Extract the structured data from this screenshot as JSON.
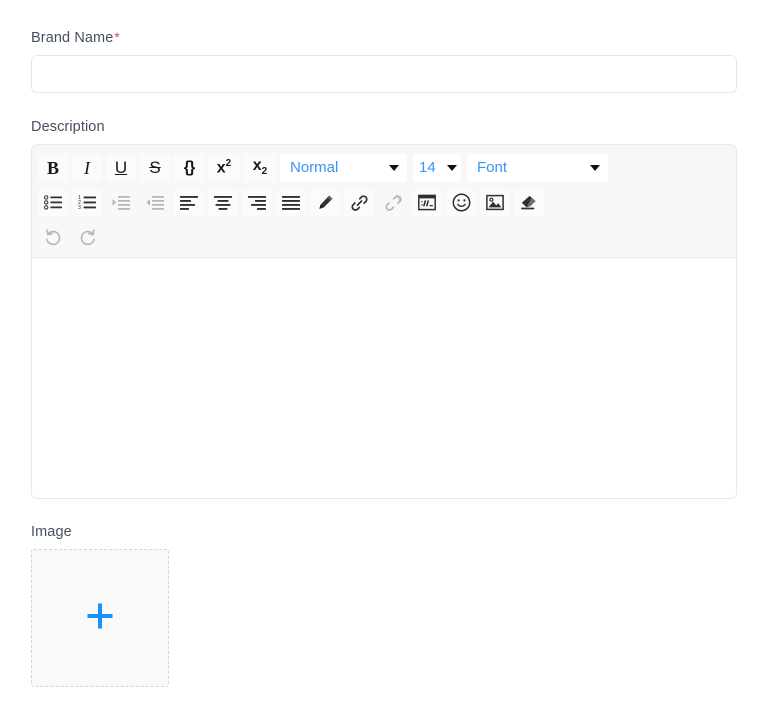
{
  "form": {
    "brand_name": {
      "label": "Brand Name",
      "required_marker": "*",
      "value": "",
      "placeholder": ""
    },
    "description": {
      "label": "Description",
      "content": "",
      "toolbar": {
        "row1": [
          {
            "name": "bold-icon",
            "label": "B",
            "title": "Bold",
            "disabled": false
          },
          {
            "name": "italic-icon",
            "label": "I",
            "title": "Italic",
            "disabled": false
          },
          {
            "name": "underline-icon",
            "label": "U",
            "title": "Underline",
            "disabled": false
          },
          {
            "name": "strikethrough-icon",
            "label": "S",
            "title": "Strike",
            "disabled": false
          },
          {
            "name": "code-block-icon",
            "label": "{}",
            "title": "Code Block",
            "disabled": false
          },
          {
            "name": "superscript-icon",
            "label": "x2",
            "title": "Superscript",
            "disabled": false
          },
          {
            "name": "subscript-icon",
            "label": "x2",
            "title": "Subscript",
            "disabled": false
          }
        ],
        "selects": {
          "header": {
            "value": "Normal",
            "name": "header-select"
          },
          "size": {
            "value": "14",
            "name": "font-size-select"
          },
          "font": {
            "value": "Font",
            "name": "font-family-select"
          }
        },
        "row2": [
          {
            "name": "bullet-list-icon",
            "title": "Bulleted list",
            "disabled": false
          },
          {
            "name": "numbered-list-icon",
            "title": "Numbered list",
            "disabled": false
          },
          {
            "name": "indent-icon",
            "title": "Indent",
            "disabled": true
          },
          {
            "name": "outdent-icon",
            "title": "Outdent",
            "disabled": true
          },
          {
            "name": "align-left-icon",
            "title": "Align left",
            "disabled": false
          },
          {
            "name": "align-center-icon",
            "title": "Align center",
            "disabled": false
          },
          {
            "name": "align-right-icon",
            "title": "Align right",
            "disabled": false
          },
          {
            "name": "align-justify-icon",
            "title": "Justify",
            "disabled": false
          },
          {
            "name": "pen-icon",
            "title": "Text color",
            "disabled": false
          },
          {
            "name": "link-icon",
            "title": "Insert link",
            "disabled": false
          },
          {
            "name": "unlink-icon",
            "title": "Remove link",
            "disabled": true
          },
          {
            "name": "embed-video-icon",
            "title": "Insert video",
            "disabled": false
          },
          {
            "name": "emoji-icon",
            "title": "Emoji",
            "disabled": false
          },
          {
            "name": "insert-image-icon",
            "title": "Insert image",
            "disabled": false
          },
          {
            "name": "eraser-icon",
            "title": "Clear format",
            "disabled": false
          }
        ],
        "row3": [
          {
            "name": "undo-icon",
            "title": "Undo",
            "disabled": true
          },
          {
            "name": "redo-icon",
            "title": "Redo",
            "disabled": true
          }
        ]
      }
    },
    "image": {
      "label": "Image",
      "add_icon": "plus-icon"
    }
  },
  "colors": {
    "accent_blue": "#1890ff",
    "select_blue": "#3b93f7",
    "required_red": "#e8445a",
    "label_gray": "#45505e",
    "toolbar_bg": "#f7f7f8",
    "border_gray": "#e4e6e9"
  }
}
